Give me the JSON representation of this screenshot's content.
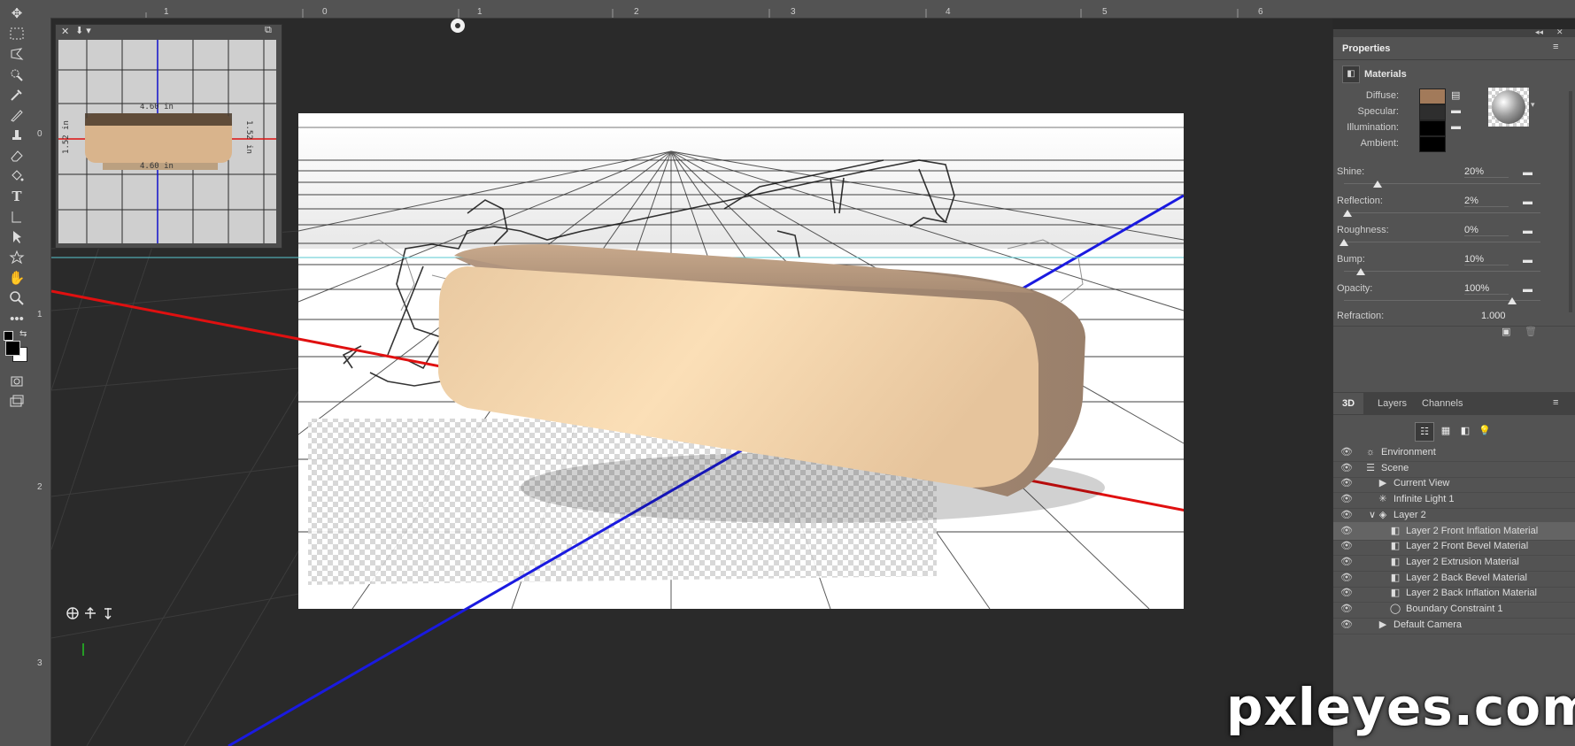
{
  "ruler": {
    "top_labels": [
      "1",
      "0",
      "1",
      "2",
      "3",
      "4",
      "5",
      "6"
    ],
    "left_labels": [
      "0",
      "1",
      "2",
      "3"
    ]
  },
  "toolbar": {
    "tools": [
      "move-tool",
      "marquee-tool",
      "lasso-tool",
      "quick-selection-tool",
      "eyedropper-tool",
      "brush-tool",
      "clone-stamp-tool",
      "eraser-tool",
      "paint-bucket-tool",
      "type-tool",
      "path-selection-tool",
      "direct-selection-tool",
      "custom-shape-tool",
      "hand-tool",
      "zoom-tool",
      "more-tools",
      "default-colors",
      "swap-colors",
      "foreground-color",
      "quick-mask",
      "screen-mode"
    ]
  },
  "navigator": {
    "dim_top": "4.60 in",
    "dim_bottom": "4.60 in",
    "dim_left": "1.52 in",
    "dim_right": "1.52 in"
  },
  "properties": {
    "tab_label": "Properties",
    "section_title": "Materials",
    "labels": {
      "diffuse": "Diffuse:",
      "specular": "Specular:",
      "illumination": "Illumination:",
      "ambient": "Ambient:"
    },
    "colors": {
      "diffuse": "#a27a5a",
      "specular": "#2e2e2e",
      "illumination": "#000000",
      "ambient": "#000000"
    },
    "sliders": [
      {
        "label": "Shine:",
        "value": "20%",
        "level": 0.2
      },
      {
        "label": "Reflection:",
        "value": "2%",
        "level": 0.02
      },
      {
        "label": "Roughness:",
        "value": "0%",
        "level": 0.0
      },
      {
        "label": "Bump:",
        "value": "10%",
        "level": 0.1
      },
      {
        "label": "Opacity:",
        "value": "100%",
        "level": 1.0
      }
    ],
    "refraction_label": "Refraction:",
    "refraction_value": "1.000"
  },
  "panel3d": {
    "tabs": [
      "3D",
      "Layers",
      "Channels"
    ],
    "items": [
      {
        "label": "Environment",
        "indent": 0
      },
      {
        "label": "Scene",
        "indent": 0
      },
      {
        "label": "Current View",
        "indent": 1
      },
      {
        "label": "Infinite Light 1",
        "indent": 1
      },
      {
        "label": "Layer 2",
        "indent": 1
      },
      {
        "label": "Layer 2 Front Inflation Material",
        "indent": 2
      },
      {
        "label": "Layer 2 Front Bevel Material",
        "indent": 2
      },
      {
        "label": "Layer 2 Extrusion Material",
        "indent": 2
      },
      {
        "label": "Layer 2 Back Bevel Material",
        "indent": 2
      },
      {
        "label": "Layer 2 Back Inflation Material",
        "indent": 2
      },
      {
        "label": "Boundary Constraint 1",
        "indent": 2
      },
      {
        "label": "Default Camera",
        "indent": 1
      }
    ]
  },
  "watermark": "pxleyes.com",
  "accent_colors": {
    "x_axis": "#e01010",
    "z_axis": "#1a1ae0",
    "guide": "#58c8d0"
  }
}
